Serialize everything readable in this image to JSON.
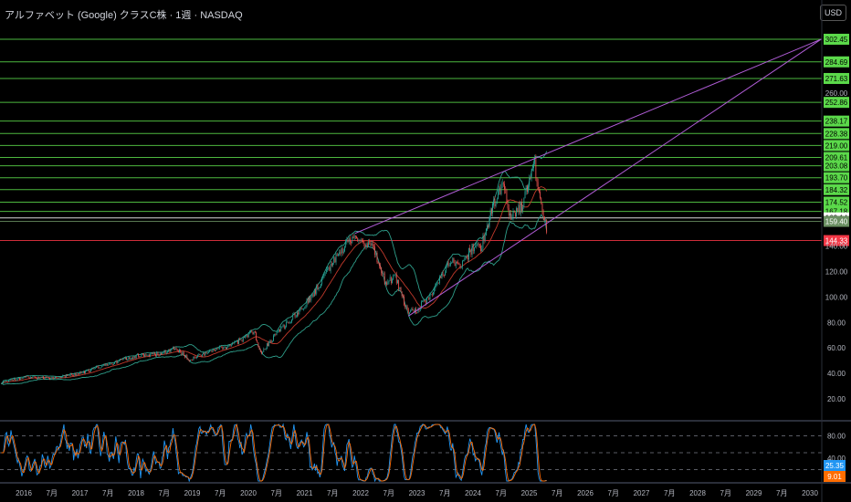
{
  "header": {
    "title": "アルファベット (Google) クラスC株 · 1週 · NASDAQ",
    "currency_button": "USD"
  },
  "chart_data": {
    "type": "candlestick",
    "interval": "weekly",
    "price_axis": {
      "ticks": [
        20,
        40,
        60,
        80,
        100,
        120,
        140,
        260
      ],
      "ylim": [
        0,
        310
      ]
    },
    "time_axis": {
      "ticks": [
        {
          "t": 2016.0,
          "label": "2016"
        },
        {
          "t": 2016.5,
          "label": "7月"
        },
        {
          "t": 2017.0,
          "label": "2017"
        },
        {
          "t": 2017.5,
          "label": "7月"
        },
        {
          "t": 2018.0,
          "label": "2018"
        },
        {
          "t": 2018.5,
          "label": "7月"
        },
        {
          "t": 2019.0,
          "label": "2019"
        },
        {
          "t": 2019.5,
          "label": "7月"
        },
        {
          "t": 2020.0,
          "label": "2020"
        },
        {
          "t": 2020.5,
          "label": "7月"
        },
        {
          "t": 2021.0,
          "label": "2021"
        },
        {
          "t": 2021.5,
          "label": "7月"
        },
        {
          "t": 2022.0,
          "label": "2022"
        },
        {
          "t": 2022.5,
          "label": "7月"
        },
        {
          "t": 2023.0,
          "label": "2023"
        },
        {
          "t": 2023.5,
          "label": "7月"
        },
        {
          "t": 2024.0,
          "label": "2024"
        },
        {
          "t": 2024.5,
          "label": "7月"
        },
        {
          "t": 2025.0,
          "label": "2025"
        },
        {
          "t": 2025.5,
          "label": "7月"
        },
        {
          "t": 2026.0,
          "label": "2026"
        },
        {
          "t": 2026.5,
          "label": "7月"
        },
        {
          "t": 2027.0,
          "label": "2027"
        },
        {
          "t": 2027.5,
          "label": "7月"
        },
        {
          "t": 2028.0,
          "label": "2028"
        },
        {
          "t": 2028.5,
          "label": "7月"
        },
        {
          "t": 2029.0,
          "label": "2029"
        },
        {
          "t": 2029.5,
          "label": "7月"
        },
        {
          "t": 2030.0,
          "label": "2030"
        }
      ]
    },
    "price_path": [
      [
        2015.6,
        33
      ],
      [
        2016.0,
        37
      ],
      [
        2016.5,
        36
      ],
      [
        2017.0,
        40
      ],
      [
        2017.5,
        47
      ],
      [
        2018.0,
        54
      ],
      [
        2018.4,
        55
      ],
      [
        2018.7,
        60
      ],
      [
        2018.95,
        51
      ],
      [
        2019.4,
        58
      ],
      [
        2019.7,
        62
      ],
      [
        2020.1,
        73
      ],
      [
        2020.22,
        55
      ],
      [
        2020.5,
        72
      ],
      [
        2020.9,
        88
      ],
      [
        2021.2,
        105
      ],
      [
        2021.5,
        128
      ],
      [
        2021.87,
        148
      ],
      [
        2022.0,
        145
      ],
      [
        2022.2,
        140
      ],
      [
        2022.45,
        110
      ],
      [
        2022.6,
        117
      ],
      [
        2022.85,
        87
      ],
      [
        2023.0,
        90
      ],
      [
        2023.3,
        105
      ],
      [
        2023.6,
        130
      ],
      [
        2023.8,
        125
      ],
      [
        2024.0,
        140
      ],
      [
        2024.15,
        140
      ],
      [
        2024.35,
        170
      ],
      [
        2024.55,
        190
      ],
      [
        2024.65,
        165
      ],
      [
        2024.85,
        170
      ],
      [
        2025.0,
        190
      ],
      [
        2025.1,
        205
      ],
      [
        2025.2,
        175
      ],
      [
        2025.3,
        158
      ],
      [
        2025.33,
        146
      ]
    ],
    "indicators": [
      "Bollinger Bands",
      "Moving Average",
      "Stochastic RSI"
    ],
    "levels": [
      {
        "price": 302.45,
        "label": "302.45",
        "color": "#5bd94a"
      },
      {
        "price": 284.69,
        "label": "284.69",
        "color": "#5bd94a"
      },
      {
        "price": 271.63,
        "label": "271.63",
        "color": "#5bd94a"
      },
      {
        "price": 252.86,
        "label": "252.86",
        "color": "#5bd94a"
      },
      {
        "price": 238.17,
        "label": "238.17",
        "color": "#5bd94a"
      },
      {
        "price": 228.38,
        "label": "228.38",
        "color": "#5bd94a"
      },
      {
        "price": 219.0,
        "label": "219.00",
        "color": "#5bd94a"
      },
      {
        "price": 209.61,
        "label": "209.61",
        "color": "#5bd94a"
      },
      {
        "price": 203.08,
        "label": "203.08",
        "color": "#5bd94a"
      },
      {
        "price": 193.7,
        "label": "193.70",
        "color": "#5bd94a"
      },
      {
        "price": 184.32,
        "label": "184.32",
        "color": "#5bd94a"
      },
      {
        "price": 174.52,
        "label": "174.52",
        "color": "#5bd94a"
      },
      {
        "price": 167.18,
        "label": "167.18",
        "color": "#5bd94a"
      },
      {
        "price": 162.14,
        "label": "162.14",
        "color": "#ffffff"
      },
      {
        "price": 159.4,
        "label": "159.40",
        "color": "#6a8f62"
      },
      {
        "price": 144.33,
        "label": "144.33",
        "color": "#f23645"
      }
    ],
    "trendlines": [
      {
        "from": [
          2021.9,
          150
        ],
        "to": [
          2030.2,
          302.45
        ],
        "color": "#b05cd6"
      },
      {
        "from": [
          2022.85,
          85
        ],
        "to": [
          2030.2,
          302.45
        ],
        "color": "#b05cd6"
      }
    ],
    "oscillator": {
      "ticks": [
        {
          "v": 80,
          "label": "80.00"
        },
        {
          "v": 40,
          "label": "40.00"
        }
      ],
      "dashed_levels": [
        80,
        50,
        20
      ],
      "k": {
        "value": "25.35",
        "color": "#2196f3"
      },
      "d": {
        "value": "9.01",
        "color": "#ff6d00"
      }
    },
    "colors": {
      "up": "#26a69a",
      "down": "#ef5350",
      "bands": "#2e9e8a",
      "ma": "#c0392b"
    }
  }
}
